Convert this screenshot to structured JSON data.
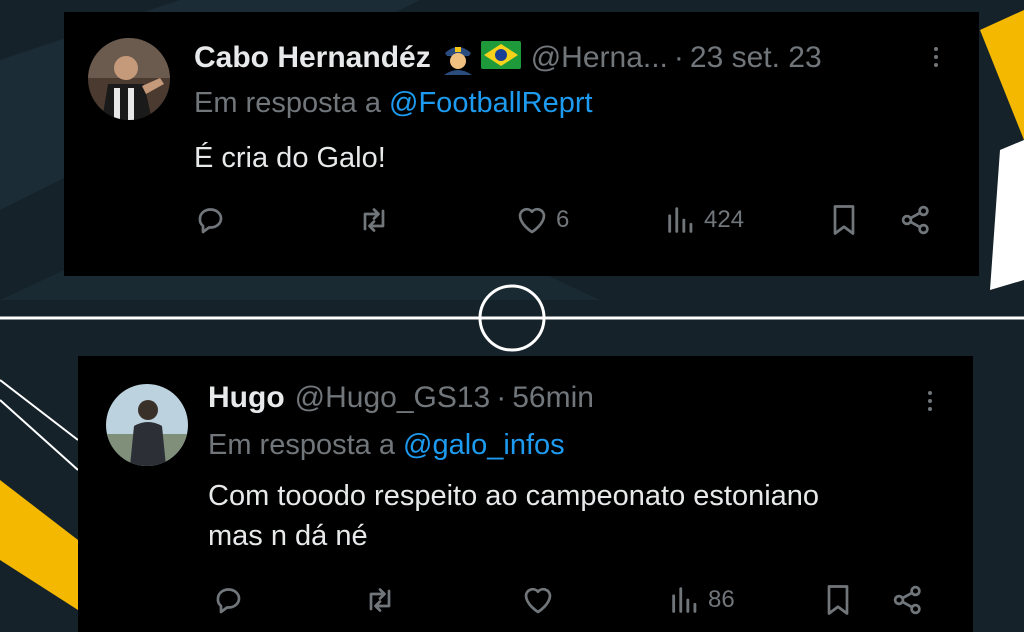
{
  "colors": {
    "background": "#16232b",
    "card": "#000000",
    "text": "#e7e9ea",
    "muted": "#71767b",
    "link": "#1d9bf0",
    "accent_yellow": "#f5b800"
  },
  "tweets": [
    {
      "author_name": "Cabo Hernandéz",
      "emoji": [
        "police-officer-emoji",
        "brazil-flag-emoji"
      ],
      "handle": "@Herna...",
      "dot": "·",
      "time": "23 set. 23",
      "reply_prefix": "Em resposta a ",
      "reply_to": "@FootballReprt",
      "text": "É cria do Galo!",
      "likes": "6",
      "views": "424"
    },
    {
      "author_name": "Hugo",
      "handle": "@Hugo_GS13",
      "dot": "·",
      "time": "56min",
      "reply_prefix": "Em resposta a ",
      "reply_to": "@galo_infos",
      "text_line1": "Com tooodo respeito ao campeonato estoniano",
      "text_line2": "mas n dá né",
      "likes": "",
      "views": "86"
    }
  ]
}
